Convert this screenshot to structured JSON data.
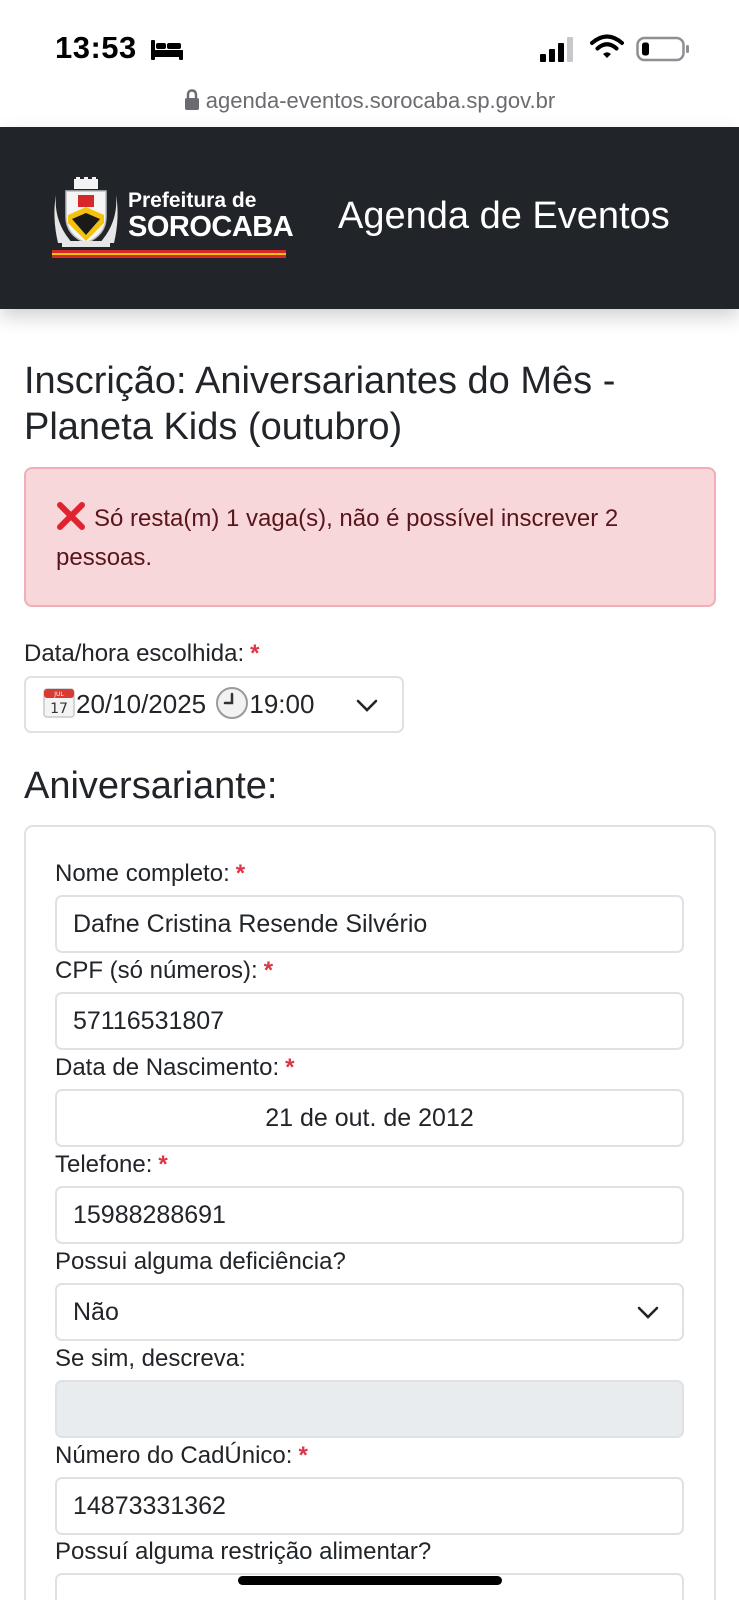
{
  "status_bar": {
    "time": "13:53"
  },
  "browser": {
    "url": "agenda-eventos.sorocaba.sp.gov.br"
  },
  "header": {
    "logo_line1": "Prefeitura de",
    "logo_line2": "SOROCABA",
    "title": "Agenda de Eventos"
  },
  "page": {
    "title": "Inscrição: Aniversariantes do Mês - Planeta Kids (outubro)",
    "alert": "Só resta(m) 1 vaga(s), não é possível inscrever 2 pessoas.",
    "datetime_label": "Data/hora escolhida:",
    "datetime_date": "20/10/2025",
    "datetime_time": "19:00",
    "section_title": "Aniversariante:",
    "required_mark": "*"
  },
  "form": {
    "nome": {
      "label": "Nome completo:",
      "value": "Dafne Cristina Resende Silvério"
    },
    "cpf": {
      "label": "CPF (só números):",
      "value": "57116531807"
    },
    "nascimento": {
      "label": "Data de Nascimento:",
      "value": "21 de out. de 2012"
    },
    "telefone": {
      "label": "Telefone:",
      "value": "15988288691"
    },
    "deficiencia": {
      "label": "Possui alguma deficiência?",
      "value": "Não"
    },
    "descreva": {
      "label": "Se sim, descreva:",
      "value": ""
    },
    "cadunico": {
      "label": "Número do CadÚnico:",
      "value": "14873331362"
    },
    "restricao": {
      "label": "Possuí alguma restrição alimentar?"
    }
  },
  "colors": {
    "header_bg": "#212529",
    "alert_bg": "#f8d7da",
    "alert_border": "#f1aeb5",
    "alert_text": "#58151c",
    "required": "#dc3545",
    "input_border": "#dee2e6",
    "disabled_bg": "#e9ecef"
  },
  "icons": [
    "bed-icon",
    "signal-icon",
    "wifi-icon",
    "battery-icon",
    "lock-icon",
    "crest-icon",
    "x-icon",
    "calendar-icon",
    "clock-icon",
    "chevron-down-icon"
  ]
}
